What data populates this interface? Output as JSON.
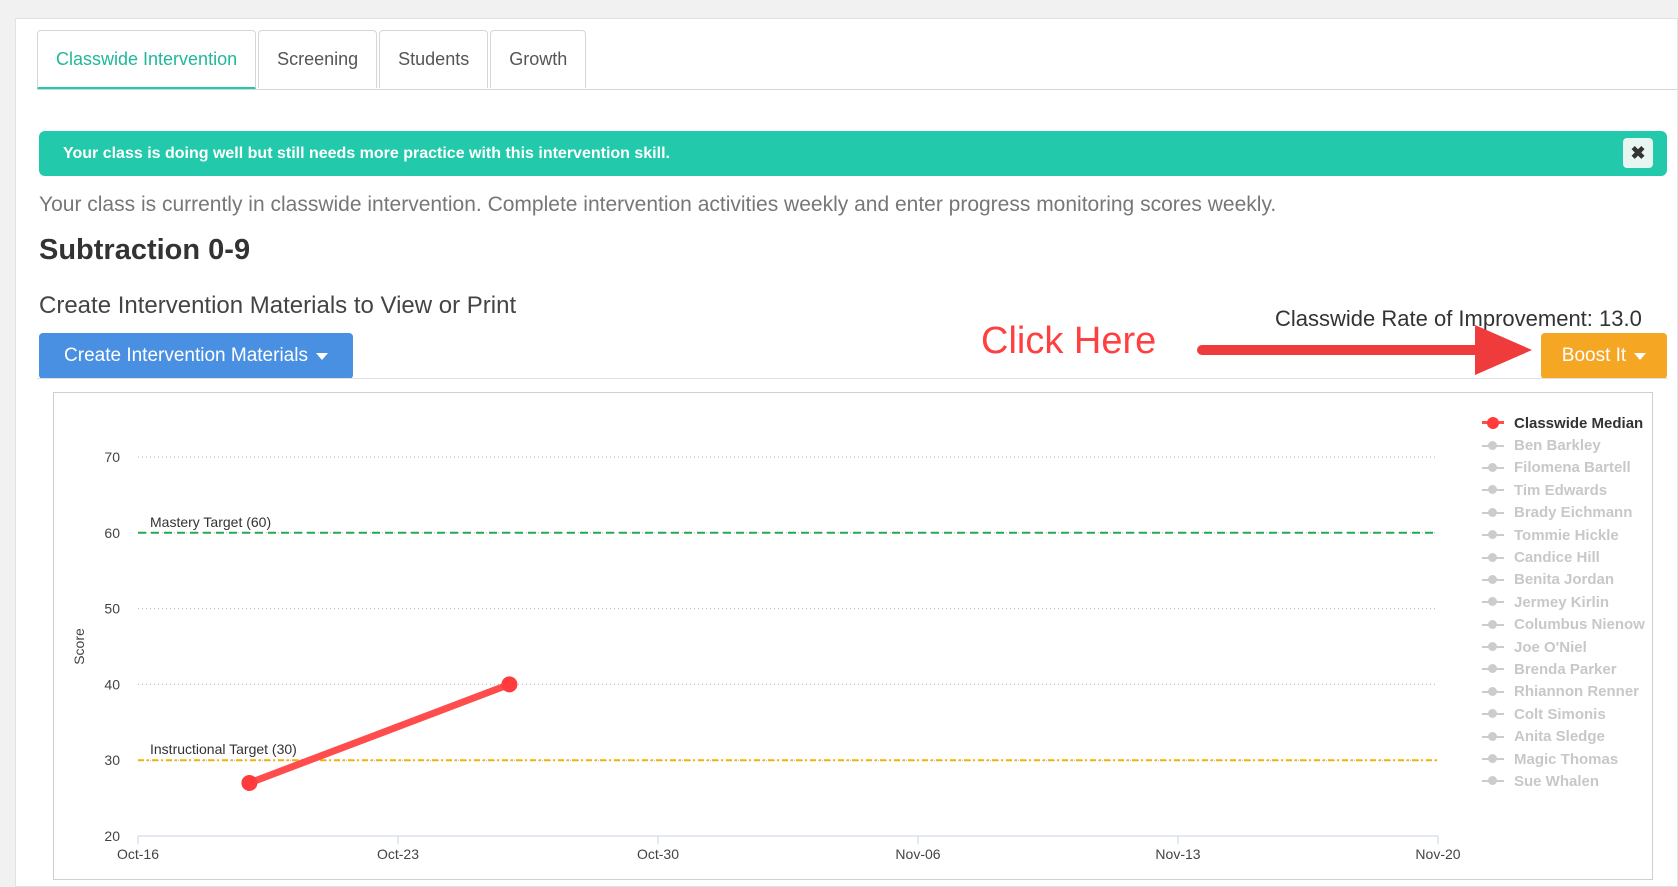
{
  "tabs": [
    {
      "label": "Classwide Intervention",
      "active": true
    },
    {
      "label": "Screening",
      "active": false
    },
    {
      "label": "Students",
      "active": false
    },
    {
      "label": "Growth",
      "active": false
    }
  ],
  "alert": {
    "message": "Your class is doing well but still needs more practice with this intervention skill.",
    "close_glyph": "✖"
  },
  "info_text": "Your class is currently in classwide intervention. Complete intervention activities weekly and enter progress monitoring scores weekly.",
  "skill_title": "Subtraction 0-9",
  "create_section": {
    "label": "Create Intervention Materials to View or Print",
    "button_label": "Create Intervention Materials"
  },
  "rate_of_improvement": {
    "label": "Classwide Rate of Improvement: 13.0"
  },
  "boost_button": {
    "label": "Boost It"
  },
  "callout": {
    "text": "Click Here",
    "color": "#ff4040"
  },
  "colors": {
    "accent": "#22c9aa",
    "primary_button": "#4a90e2",
    "boost_button": "#f5a623",
    "median_line": "#ff4d4d",
    "mastery_line": "#22aa55",
    "instructional_line": "#f0b400"
  },
  "chart_data": {
    "type": "line",
    "xlabel": "",
    "ylabel": "Score",
    "x_ticks": [
      "Oct-16",
      "Oct-23",
      "Oct-30",
      "Nov-06",
      "Nov-13",
      "Nov-20"
    ],
    "y_ticks": [
      20,
      30,
      40,
      50,
      60,
      70
    ],
    "ylim": [
      20,
      70
    ],
    "xlim": [
      "Oct-16",
      "Nov-20"
    ],
    "grid": "horizontal dotted",
    "legend_position": "right",
    "series": [
      {
        "name": "Classwide Median",
        "points": [
          {
            "x": "Oct-19",
            "y": 27
          },
          {
            "x": "Oct-26",
            "y": 40
          }
        ]
      }
    ],
    "hidden_series": [
      "Ben Barkley",
      "Filomena Bartell",
      "Tim Edwards",
      "Brady Eichmann",
      "Tommie Hickle",
      "Candice Hill",
      "Benita Jordan",
      "Jermey Kirlin",
      "Columbus Nienow",
      "Joe O'Niel",
      "Brenda Parker",
      "Rhiannon Renner",
      "Colt Simonis",
      "Anita Sledge",
      "Magic Thomas",
      "Sue Whalen"
    ],
    "reference_lines": [
      {
        "label": "Mastery Target (60)",
        "y": 60
      },
      {
        "label": "Instructional Target (30)",
        "y": 30
      }
    ]
  }
}
